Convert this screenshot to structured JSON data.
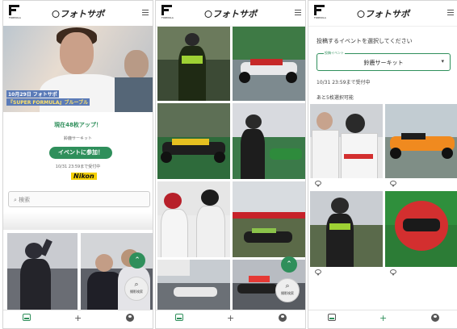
{
  "app": {
    "brand": "フォトサポ",
    "logo_text": "FORMULA"
  },
  "colors": {
    "accent": "#2f8f5b",
    "sponsor": "#f4d000"
  },
  "home": {
    "hero_caption_line1": "10月29日 フォトサポ",
    "hero_caption_line2": "『SUPER FORMULA』ブルーブル",
    "uploads": "現在48枚アップ！",
    "circuit": "鈴鹿サーキット",
    "event_button": "イベントに参加！",
    "deadline": "10/31 23:59まで受付中",
    "sponsor": "Nikon",
    "search_placeholder": "検索",
    "search_fab_label": "撮影検索"
  },
  "gallery": {
    "search_fab_label": "撮影検索"
  },
  "select": {
    "prompt": "投稿するイベントを選択してください",
    "field_label": "投稿イベント",
    "value": "鈴鹿サーキット",
    "deadline": "10/31 23:59まで受付中",
    "remaining": "あと5枚選択可能"
  },
  "nav": {
    "gallery_icon": "image-icon",
    "add_icon": "plus-icon",
    "add_symbol": "+",
    "account_icon": "user-icon"
  }
}
